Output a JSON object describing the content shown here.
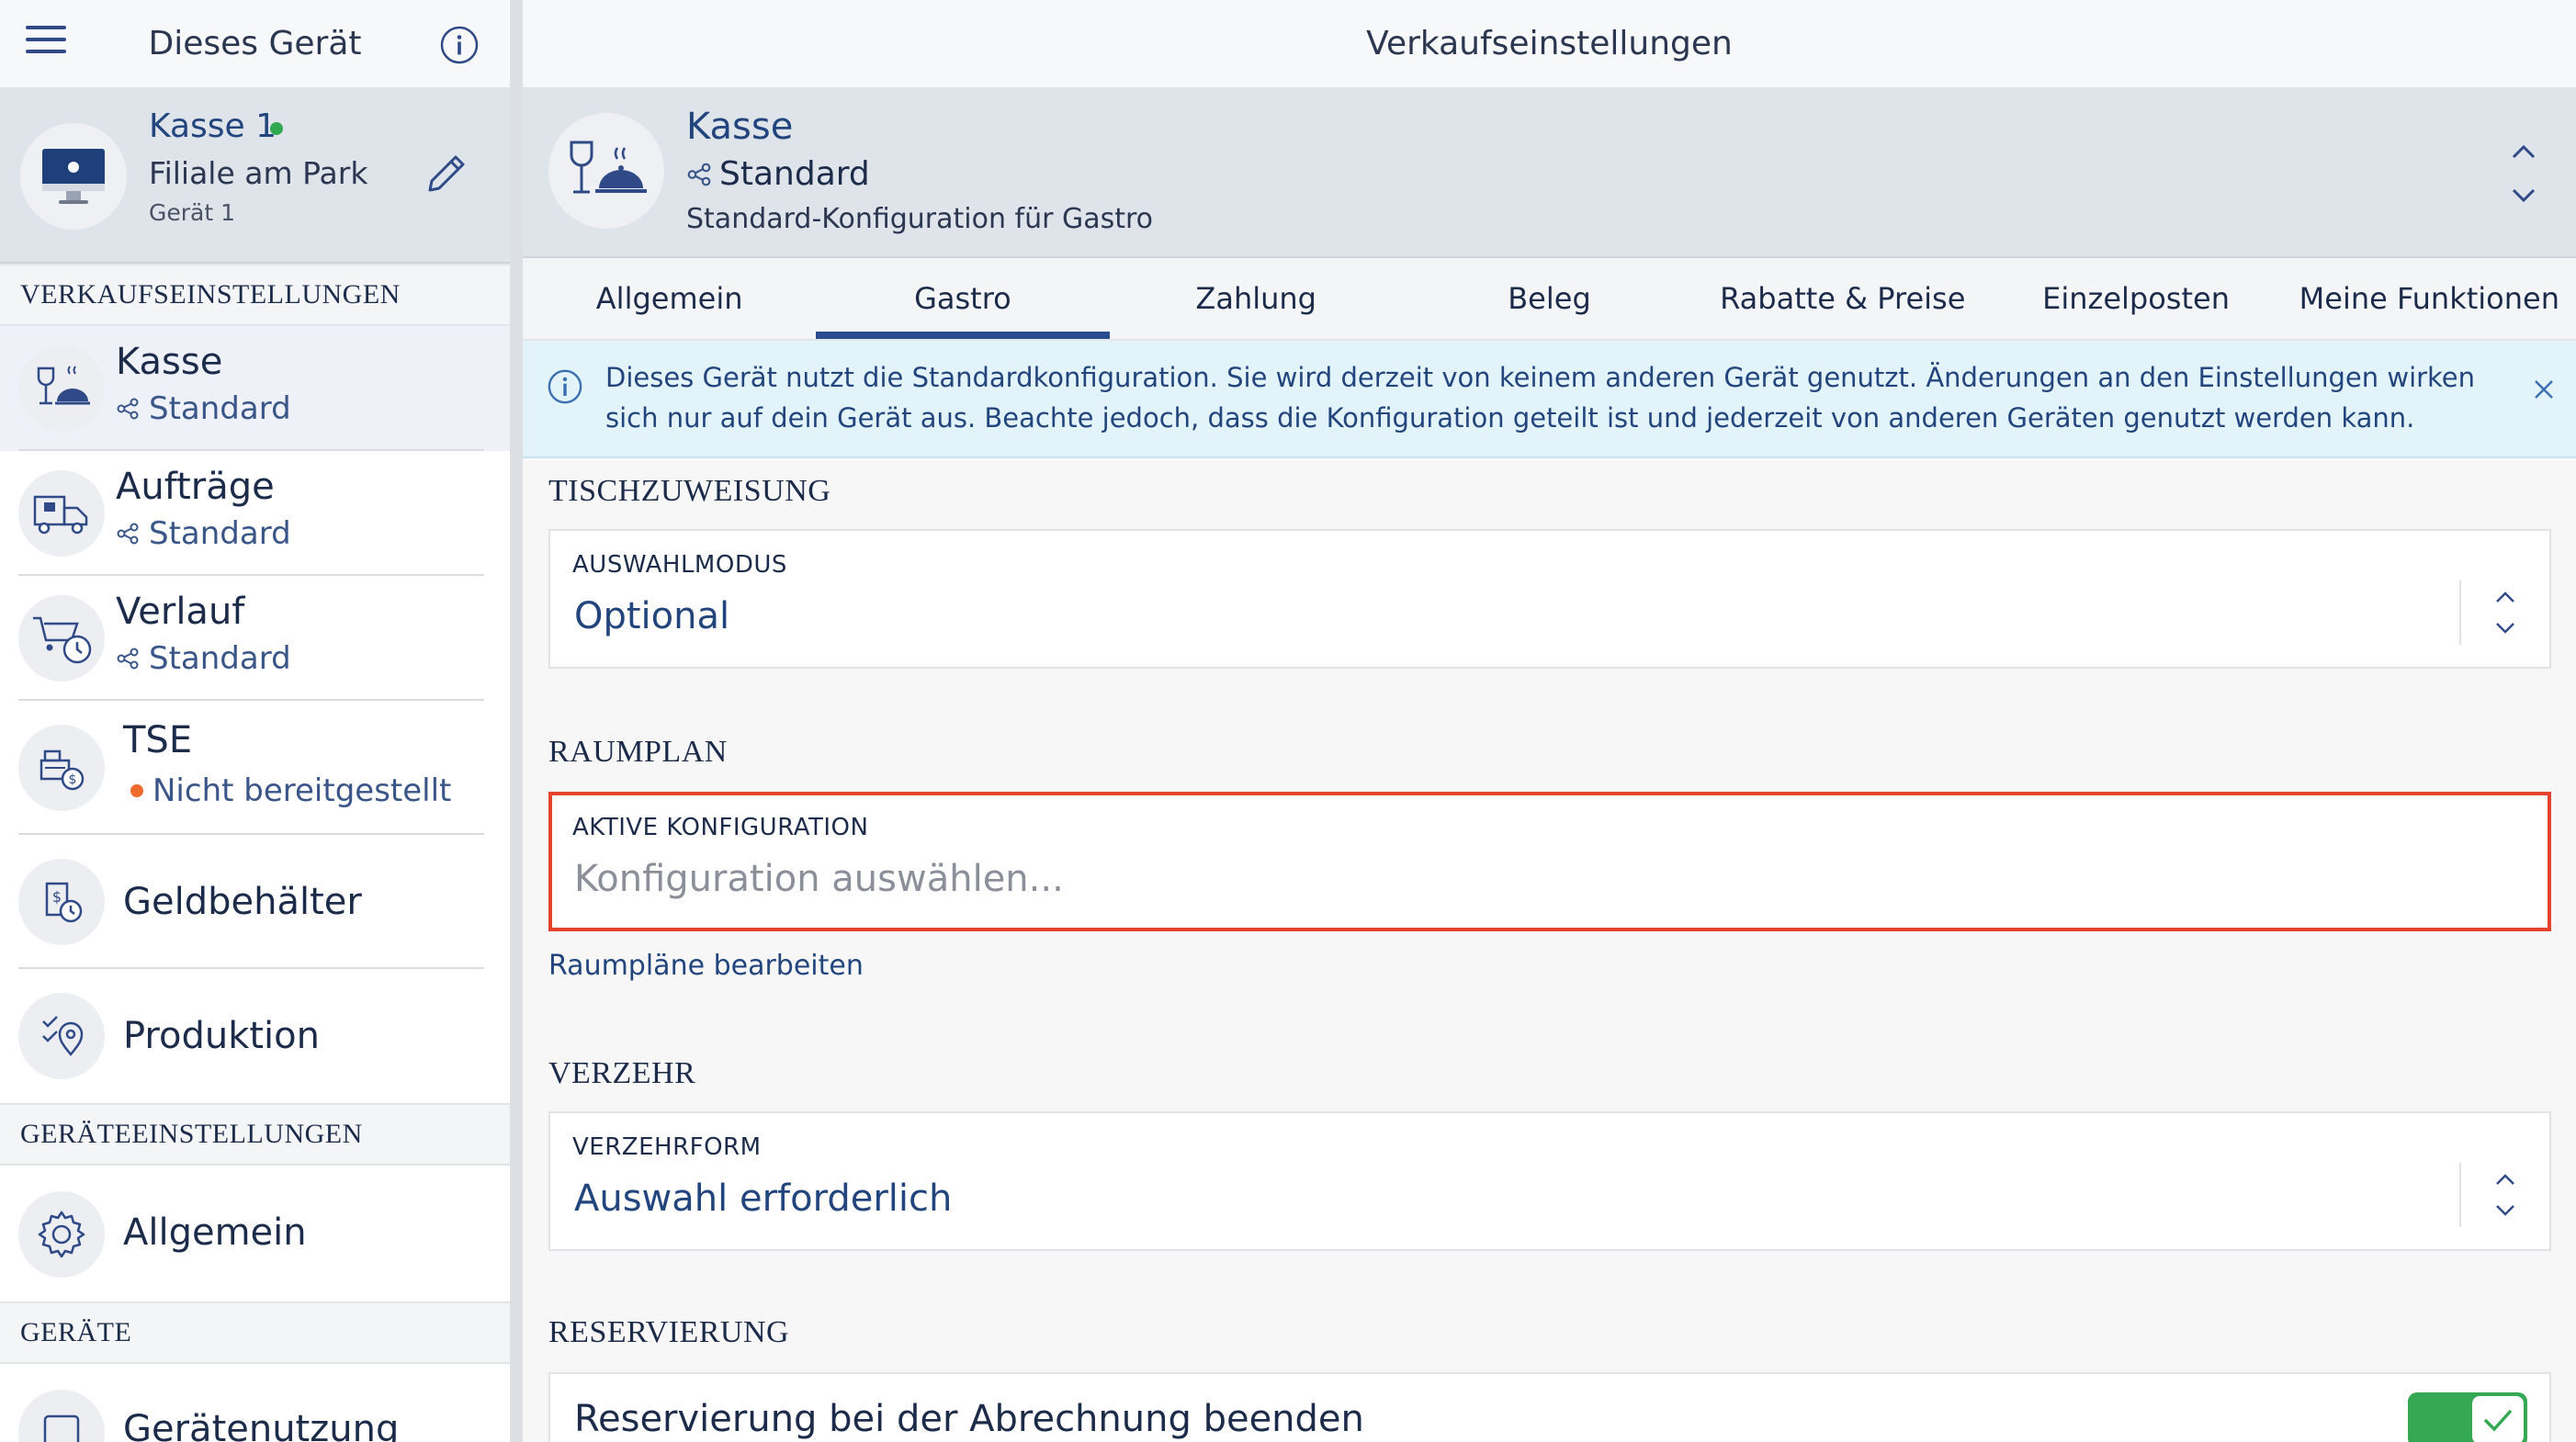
{
  "left_header": {
    "title": "Dieses Gerät"
  },
  "device": {
    "name": "Kasse 1",
    "branch": "Filiale am Park",
    "sub": "Gerät 1",
    "status_color": "#2fa84f"
  },
  "sections": {
    "sales": "VERKAUFSEINSTELLUNGEN",
    "device_settings": "GERÄTEEINSTELLUNGEN",
    "devices": "GERÄTE"
  },
  "nav": {
    "kasse": {
      "label": "Kasse",
      "sub": "Standard",
      "icon": "wine-cloche-icon"
    },
    "auftraege": {
      "label": "Aufträge",
      "sub": "Standard",
      "icon": "delivery-truck-icon"
    },
    "verlauf": {
      "label": "Verlauf",
      "sub": "Standard",
      "icon": "cart-history-icon"
    },
    "tse": {
      "label": "TSE",
      "sub": "Nicht bereitgestellt",
      "icon": "tse-register-icon",
      "status_color": "#f06a2e"
    },
    "geldbehaelter": {
      "label": "Geldbehälter",
      "icon": "cash-drawer-icon"
    },
    "produktion": {
      "label": "Produktion",
      "icon": "production-icon"
    },
    "allgemein": {
      "label": "Allgemein",
      "icon": "gear-icon"
    },
    "geraetenutzung": {
      "label": "Gerätenutzung",
      "icon": "device-usage-icon"
    }
  },
  "right_header": {
    "title": "Verkaufseinstellungen"
  },
  "config": {
    "name": "Kasse",
    "variant": "Standard",
    "description": "Standard-Konfiguration für Gastro"
  },
  "tabs": [
    {
      "label": "Allgemein",
      "active": false
    },
    {
      "label": "Gastro",
      "active": true
    },
    {
      "label": "Zahlung",
      "active": false
    },
    {
      "label": "Beleg",
      "active": false
    },
    {
      "label": "Rabatte & Preise",
      "active": false
    },
    {
      "label": "Einzelposten",
      "active": false
    },
    {
      "label": "Meine Funktionen",
      "active": false
    }
  ],
  "banner": {
    "text": "Dieses Gerät nutzt die Standardkonfiguration. Sie wird derzeit von keinem anderen Gerät genutzt. Änderungen an den Einstellungen wirken sich nur auf dein Gerät aus. Beachte jedoch, dass die Konfiguration geteilt ist und jederzeit von anderen Geräten genutzt werden kann."
  },
  "tischzuweisung": {
    "title": "TISCHZUWEISUNG",
    "field_label": "AUSWAHLMODUS",
    "field_value": "Optional"
  },
  "raumplan": {
    "title": "RAUMPLAN",
    "field_label": "AKTIVE KONFIGURATION",
    "field_placeholder": "Konfiguration auswählen...",
    "link": "Raumpläne bearbeiten"
  },
  "verzehr": {
    "title": "VERZEHR",
    "field_label": "VERZEHRFORM",
    "field_value": "Auswahl erforderlich"
  },
  "reservierung": {
    "title": "RESERVIERUNG",
    "toggle_label": "Reservierung bei der Abrechnung beenden",
    "toggle_on": true
  },
  "colors": {
    "accent": "#2a4d8f",
    "error": "#e5432e",
    "toggle_on": "#35a853",
    "banner_bg": "#e3f3fa"
  }
}
